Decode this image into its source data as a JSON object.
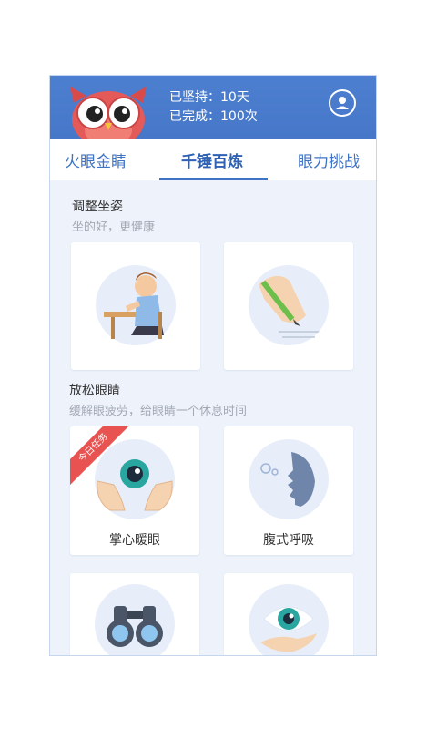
{
  "header": {
    "persist_text": "已坚持：10天",
    "completed_text": "已完成：100次",
    "accent_color": "#4677c8"
  },
  "tabs": [
    {
      "label": "火眼金睛",
      "active": false
    },
    {
      "label": "千锤百炼",
      "active": true
    },
    {
      "label": "眼力挑战",
      "active": false
    }
  ],
  "sections": [
    {
      "title": "调整坐姿",
      "subtitle": "坐的好，更健康"
    },
    {
      "title": "放松眼睛",
      "subtitle": "缓解眼疲劳，给眼睛一个休息时间"
    }
  ],
  "cards": {
    "posture_1": {
      "icon": "writing-boy-icon"
    },
    "posture_2": {
      "icon": "pen-grip-icon"
    },
    "palm_warm": {
      "label": "掌心暖眼",
      "badge": "今日任务",
      "icon": "palm-eye-icon"
    },
    "abdominal": {
      "label": "腹式呼吸",
      "icon": "breathing-face-icon"
    },
    "binoculars": {
      "icon": "binoculars-icon"
    },
    "hand_eye": {
      "icon": "hand-eye-icon"
    }
  }
}
